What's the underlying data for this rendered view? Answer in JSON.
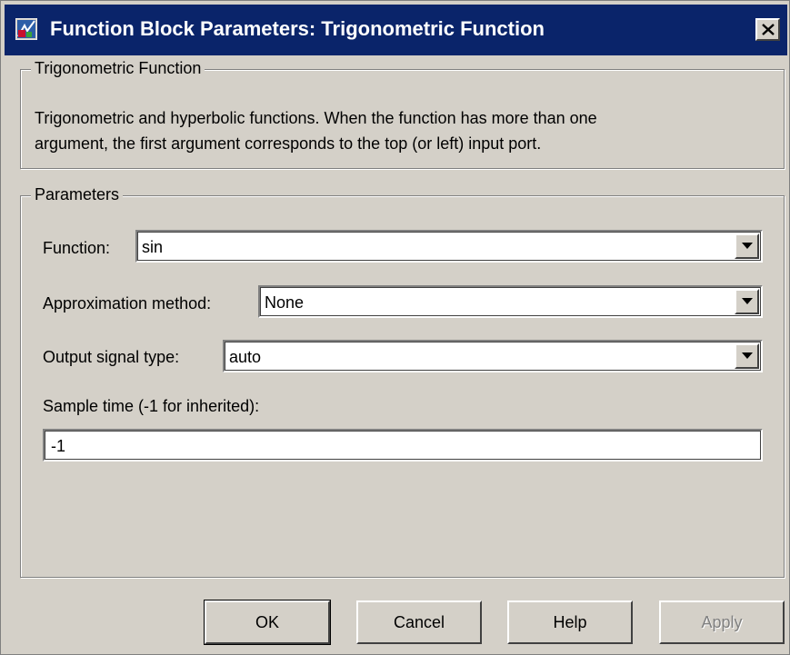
{
  "window": {
    "title": "Function Block Parameters: Trigonometric Function",
    "app_icon": "simulink-block-icon",
    "close_icon": "close-icon"
  },
  "description_group": {
    "legend": "Trigonometric Function",
    "text_line1": "Trigonometric and hyperbolic functions. When the function has more than one",
    "text_line2": "argument, the first argument corresponds to the top (or left) input port."
  },
  "parameters_group": {
    "legend": "Parameters",
    "function": {
      "label": "Function:",
      "value": "sin"
    },
    "approximation": {
      "label": "Approximation method:",
      "value": "None"
    },
    "output_type": {
      "label": "Output signal type:",
      "value": "auto"
    },
    "sample_time": {
      "label": "Sample time (-1 for inherited):",
      "value": "-1"
    }
  },
  "buttons": {
    "ok": "OK",
    "cancel": "Cancel",
    "help": "Help",
    "apply": "Apply"
  },
  "colors": {
    "titlebar": "#0a246a",
    "face": "#d4d0c8",
    "disabled_text": "#808080"
  }
}
